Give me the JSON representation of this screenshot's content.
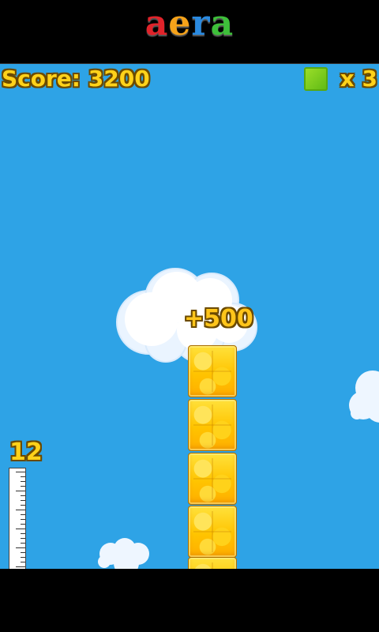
{
  "banner": {
    "logo_letters": [
      {
        "char": "a",
        "color": "#e0232a"
      },
      {
        "char": "e",
        "color": "#f5a21a"
      },
      {
        "char": "r",
        "color": "#2a8ae0"
      },
      {
        "char": "a",
        "color": "#3ebf3a"
      }
    ]
  },
  "hud": {
    "score_label": "Score: 3200",
    "lives_icon": "green-block-icon",
    "lives_label": "x 3",
    "colors": {
      "text": "#ffd21a",
      "outline": "#6b4a00",
      "sky": "#2ea3e6"
    }
  },
  "playfield": {
    "bonus_popup": "+500",
    "tower_height_label": "12",
    "ruler_icon": "ruler-icon"
  }
}
